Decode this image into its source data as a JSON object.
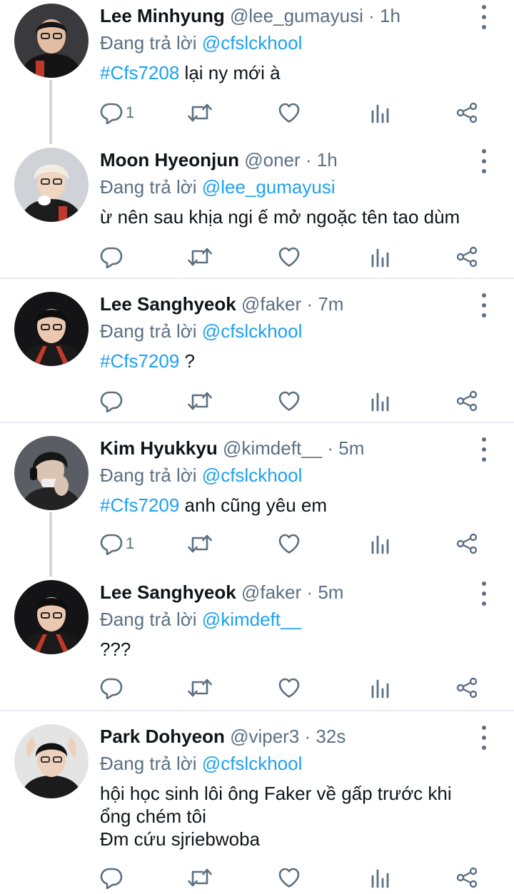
{
  "tweets": [
    {
      "name": "Lee Minhyung",
      "handle": "@lee_gumayusi",
      "dot": "·",
      "time": "1h",
      "replying_prefix": "Đang trả lời",
      "replying_to": "@cfslckhool",
      "hashtag": "#Cfs7208",
      "text": " lại ny mới à",
      "reply_count": "1"
    },
    {
      "name": "Moon Hyeonjun",
      "handle": "@oner",
      "dot": "·",
      "time": "1h",
      "replying_prefix": "Đang trả lời",
      "replying_to": "@lee_gumayusi",
      "text": "ừ nên sau khịa ngi ế mở ngoặc tên tao dùm"
    },
    {
      "name": "Lee Sanghyeok",
      "handle": "@faker",
      "dot": "·",
      "time": "7m",
      "replying_prefix": "Đang trả lời",
      "replying_to": "@cfslckhool",
      "hashtag": "#Cfs7209",
      "text": " ?"
    },
    {
      "name": "Kim Hyukkyu",
      "handle": "@kimdeft__",
      "dot": "·",
      "time": "5m",
      "replying_prefix": "Đang trả lời",
      "replying_to": "@cfslckhool",
      "hashtag": "#Cfs7209",
      "text": " anh cũng yêu em",
      "reply_count": "1"
    },
    {
      "name": "Lee Sanghyeok",
      "handle": "@faker",
      "dot": "·",
      "time": "5m",
      "replying_prefix": "Đang trả lời",
      "replying_to": "@kimdeft__",
      "text": "???"
    },
    {
      "name": "Park Dohyeon",
      "handle": "@viper3",
      "dot": "·",
      "time": "32s",
      "replying_prefix": "Đang trả lời",
      "replying_to": "@cfslckhool",
      "text_lines": [
        "hội học sinh lôi ông Faker về gấp trước khi",
        "ổng chém tôi",
        "Đm cứu sjriebwoba"
      ]
    }
  ],
  "icons": {
    "reply": "reply-icon",
    "retweet": "retweet-icon",
    "like": "like-icon",
    "analytics": "analytics-icon",
    "share": "share-icon",
    "more": "more-icon"
  },
  "colors": {
    "link": "#1da1f2",
    "secondary_text": "#5b7083",
    "primary_text": "#0f1419",
    "divider": "#e6ecf0",
    "thread_line": "#cfd9de"
  }
}
